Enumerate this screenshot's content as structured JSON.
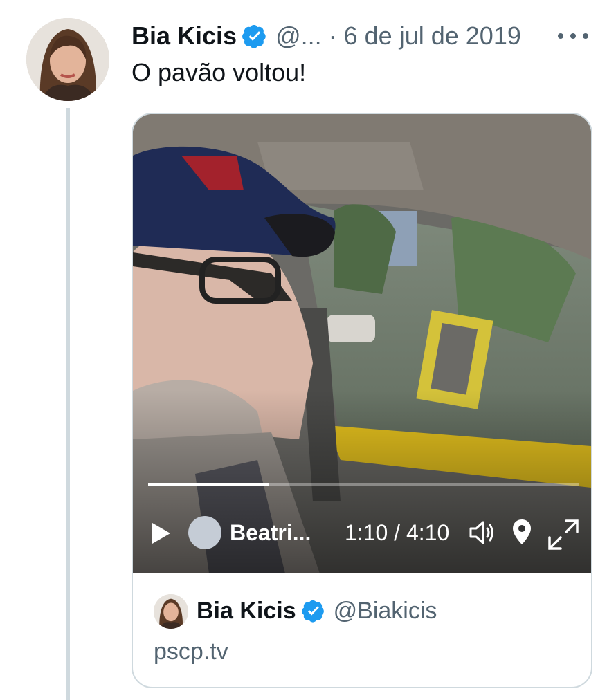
{
  "tweet": {
    "author_name": "Bia Kicis",
    "handle": "@...",
    "separator": "·",
    "date": "6 de jul de 2019",
    "text": "O pavão voltou!",
    "avatar_icon": "profile-photo",
    "verified_icon": "verified-badge-icon",
    "more_icon": "more-options-icon"
  },
  "video": {
    "broadcaster": "Beatri...",
    "timecode": "1:10 / 4:10",
    "progress": 0.28,
    "icons": [
      "play-icon",
      "volume-icon",
      "location-pin-icon",
      "fullscreen-icon"
    ]
  },
  "card_footer": {
    "name": "Bia Kicis",
    "handle": "@Biakicis",
    "domain": "pscp.tv"
  },
  "colors": {
    "verified": "#1d9bf0",
    "secondary_text": "#536471",
    "border": "#cfd9de"
  }
}
